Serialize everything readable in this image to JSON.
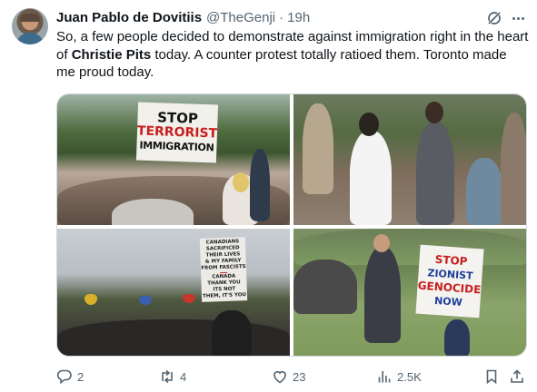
{
  "author": {
    "display_name": "Juan Pablo de Dovitiis",
    "handle": "@TheGenji",
    "separator": "·",
    "time": "19h"
  },
  "tweet": {
    "text_before": "So, a few people decided to demonstrate against immigration right in the heart of ",
    "text_bold": "Christie Pits",
    "text_after": " today. A counter protest totally ratioed them. Toronto made me proud today."
  },
  "media": {
    "photo1_sign": [
      "STOP",
      "TERRORIST",
      "IMMIGRATION"
    ],
    "photo3_sign": [
      "CANADIANS",
      "SACRIFICED",
      "THEIR LIVES",
      "& MY FAMILY",
      "FROM FASCISTS",
      "CANADA",
      "THANK YOU",
      "ITS NOT",
      "THEM, IT'S YOU"
    ],
    "photo4_sign": [
      "STOP",
      "ZIONIST",
      "GENOCIDE",
      "NOW"
    ]
  },
  "actions": {
    "replies": "2",
    "retweets": "4",
    "likes": "23",
    "views": "2.5K"
  },
  "icons": {
    "grok": "grok-icon",
    "more": "more-icon",
    "reply": "reply-icon",
    "retweet": "retweet-icon",
    "like": "heart-icon",
    "views": "views-icon",
    "bookmark": "bookmark-icon",
    "share": "share-icon"
  },
  "colors": {
    "text_primary": "#0f1419",
    "text_secondary": "#536471",
    "border": "#cfd9de",
    "sign_red": "#c81e1e"
  }
}
